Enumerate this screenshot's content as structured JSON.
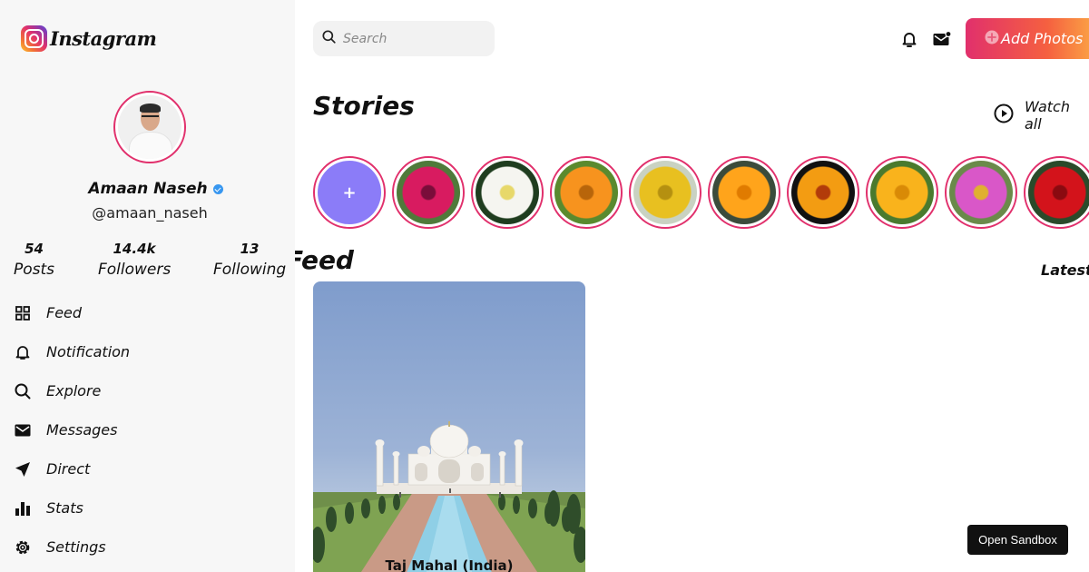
{
  "brand": {
    "name": "Instagram"
  },
  "profile": {
    "name": "Amaan Naseh",
    "handle": "@amaan_naseh",
    "verified": true,
    "stats": [
      {
        "value": "54",
        "label": "Posts"
      },
      {
        "value": "14.4k",
        "label": "Followers"
      },
      {
        "value": "13",
        "label": "Following"
      }
    ]
  },
  "nav": [
    {
      "label": "Feed",
      "icon": "grid-icon"
    },
    {
      "label": "Notification",
      "icon": "bell-icon"
    },
    {
      "label": "Explore",
      "icon": "search-icon"
    },
    {
      "label": "Messages",
      "icon": "mail-icon"
    },
    {
      "label": "Direct",
      "icon": "send-icon"
    },
    {
      "label": "Stats",
      "icon": "bar-chart-icon"
    },
    {
      "label": "Settings",
      "icon": "gear-icon"
    }
  ],
  "header": {
    "search_placeholder": "Search",
    "add_photos_label": "Add Photos"
  },
  "stories": {
    "title": "Stories",
    "watch_all_label": "Watch all",
    "items": [
      {
        "type": "add-story",
        "color": "#8b7cf8"
      },
      {
        "type": "flower",
        "petal": "#d81b60",
        "center": "#7a0d3a",
        "bg": "#4f7a3a"
      },
      {
        "type": "flower",
        "petal": "#f5f5f0",
        "center": "#e7d86a",
        "bg": "#1f3d1f"
      },
      {
        "type": "flower",
        "petal": "#f7931e",
        "center": "#b8650a",
        "bg": "#5a8a2e"
      },
      {
        "type": "flower",
        "petal": "#e8c020",
        "center": "#b59010",
        "bg": "#c9d2c2"
      },
      {
        "type": "flower",
        "petal": "#ffa41b",
        "center": "#e07b00",
        "bg": "#3b4b3b"
      },
      {
        "type": "flower",
        "petal": "#f39c12",
        "center": "#b23b0a",
        "bg": "#111111"
      },
      {
        "type": "flower",
        "petal": "#f9b31c",
        "center": "#d98a06",
        "bg": "#4a7a2e"
      },
      {
        "type": "flower",
        "petal": "#d957c8",
        "center": "#e0b030",
        "bg": "#6a8a4a"
      },
      {
        "type": "flower",
        "petal": "#d3131b",
        "center": "#8a0a10",
        "bg": "#2a4a2a"
      }
    ]
  },
  "feed": {
    "title": "Feed",
    "sort_label": "Latest",
    "posts": [
      {
        "caption": "Taj Mahal (India)"
      }
    ]
  },
  "sandbox": {
    "label": "Open Sandbox"
  },
  "colors": {
    "accent": "#e1306c",
    "gradient_end": "#fcaf45",
    "sidebar_bg": "#f7f7f7"
  }
}
